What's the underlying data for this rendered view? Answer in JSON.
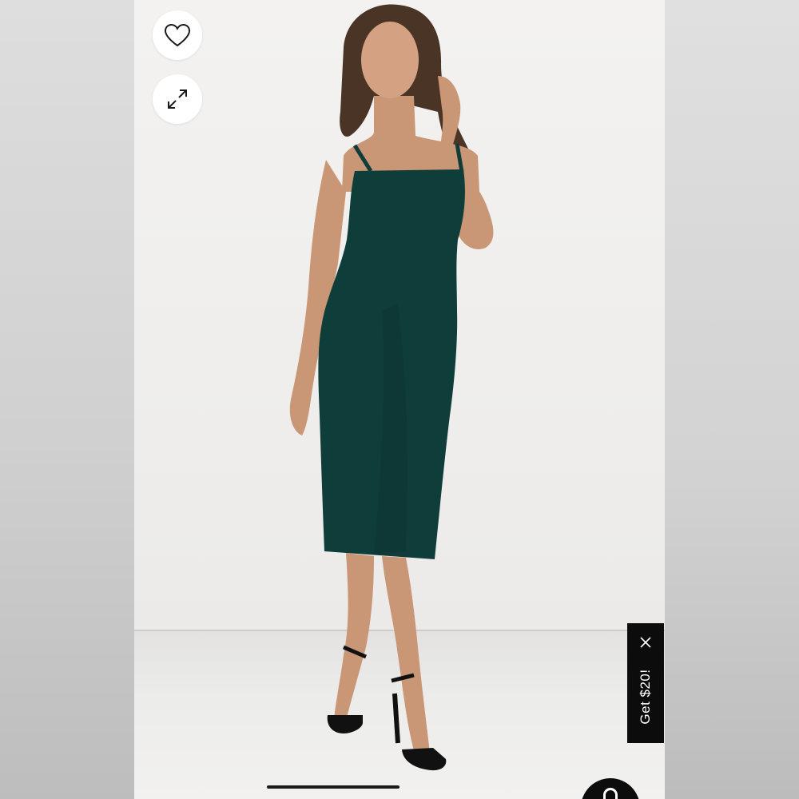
{
  "product_view": {
    "favorite_icon": "heart-outline-icon",
    "expand_icon": "expand-arrows-icon",
    "garment_color": "#0f3d3a"
  },
  "promo_tab": {
    "label": "Get $20!",
    "close_icon": "close-icon"
  },
  "chat": {
    "icon": "chat-icon"
  }
}
